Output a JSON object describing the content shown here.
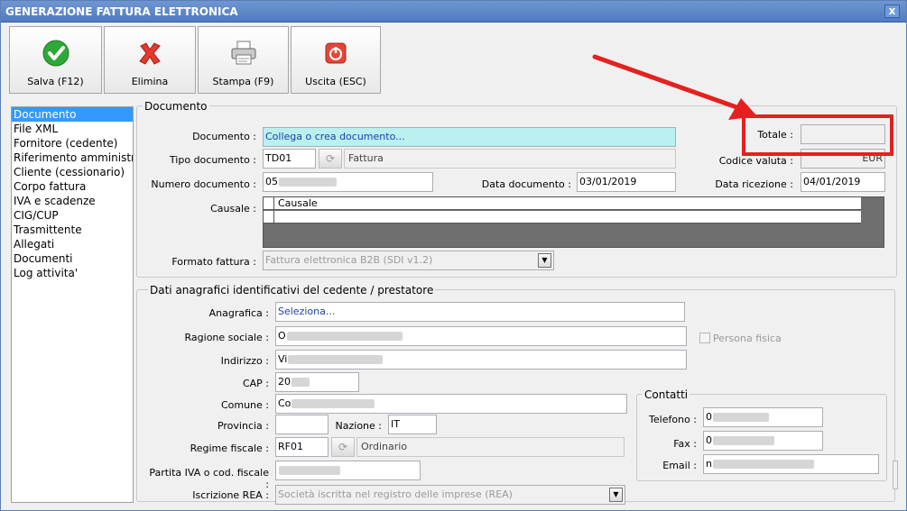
{
  "window": {
    "title": "GENERAZIONE FATTURA ELETTRONICA",
    "close_glyph": "x"
  },
  "toolbar": {
    "save_label": "Salva (F12)",
    "delete_label": "Elimina",
    "print_label": "Stampa (F9)",
    "exit_label": "Uscita (ESC)"
  },
  "nav": {
    "items": [
      "Documento",
      "File XML",
      "Fornitore (cedente)",
      "Riferimento amministra",
      "Cliente (cessionario)",
      "Corpo fattura",
      "IVA e scadenze",
      "CIG/CUP",
      "Trasmittente",
      "Allegati",
      "Documenti",
      "Log attivita'"
    ]
  },
  "documento": {
    "legend": "Documento",
    "documento_label": "Documento :",
    "documento_value": "Collega o crea documento...",
    "tipo_label": "Tipo documento :",
    "tipo_code": "TD01",
    "tipo_desc": "Fattura",
    "numero_label": "Numero documento :",
    "numero_value": "05",
    "data_label": "Data documento :",
    "data_value": "03/01/2019",
    "causale_label": "Causale :",
    "causale_header": "Causale",
    "formato_label": "Formato fattura :",
    "formato_value": "Fattura elettronica B2B (SDI v1.2)",
    "totale_label": "Totale :",
    "totale_value": "",
    "valuta_label": "Codice valuta :",
    "valuta_value": "EUR",
    "ricezione_label": "Data ricezione :",
    "ricezione_value": "04/01/2019"
  },
  "cedente": {
    "legend": "Dati anagrafici identificativi del cedente / prestatore",
    "anagrafica_label": "Anagrafica :",
    "anagrafica_value": "Seleziona...",
    "ragione_label": "Ragione sociale :",
    "ragione_value": "O",
    "persona_fisica_label": "Persona fisica",
    "indirizzo_label": "Indirizzo :",
    "indirizzo_value": "Vi",
    "cap_label": "CAP :",
    "cap_value": "20",
    "comune_label": "Comune :",
    "comune_value": "Co",
    "provincia_label": "Provincia :",
    "provincia_value": "",
    "nazione_label": "Nazione :",
    "nazione_value": "IT",
    "regime_label": "Regime fiscale :",
    "regime_code": "RF01",
    "regime_desc": "Ordinario",
    "piva_label": "Partita IVA o cod. fiscale :",
    "piva_value": "",
    "rea_label": "Iscrizione REA :",
    "rea_value": "Società iscritta nel registro delle imprese (REA)"
  },
  "contatti": {
    "legend": "Contatti",
    "telefono_label": "Telefono :",
    "telefono_value": "0",
    "fax_label": "Fax :",
    "fax_value": "0",
    "email_label": "Email :",
    "email_value": "n"
  }
}
